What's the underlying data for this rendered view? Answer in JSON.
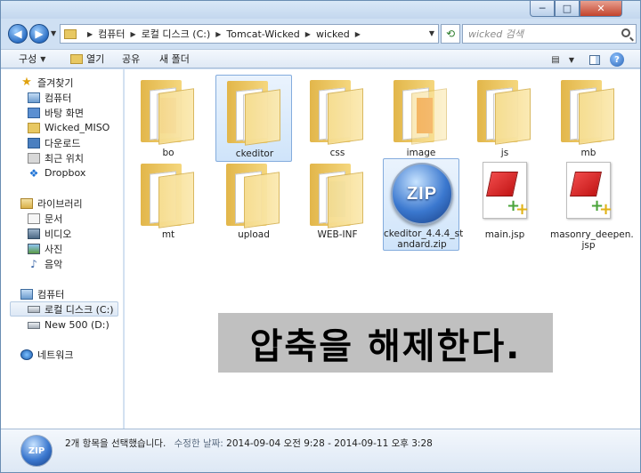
{
  "window": {
    "minimize_glyph": "─",
    "maximize_glyph": "□",
    "close_glyph": "✕"
  },
  "address": {
    "crumbs": [
      "컴퓨터",
      "로컬 디스크 (C:)",
      "Tomcat-Wicked",
      "wicked"
    ],
    "search_placeholder": "wicked 검색"
  },
  "toolbar": {
    "organize": "구성",
    "open": "열기",
    "share": "공유",
    "new_folder": "새 폴더"
  },
  "sidebar": {
    "favorites": "즐겨찾기",
    "fav_items": [
      "컴퓨터",
      "바탕 화면",
      "Wicked_MISO",
      "다운로드",
      "최근 위치",
      "Dropbox"
    ],
    "libraries": "라이브러리",
    "lib_items": [
      "문서",
      "비디오",
      "사진",
      "음악"
    ],
    "computer": "컴퓨터",
    "computer_items": [
      "로컬 디스크 (C:)",
      "New 500 (D:)"
    ],
    "network": "네트워크"
  },
  "files": [
    {
      "name": "bo",
      "type": "folder"
    },
    {
      "name": "ckeditor",
      "type": "folder"
    },
    {
      "name": "css",
      "type": "folder"
    },
    {
      "name": "image",
      "type": "folder"
    },
    {
      "name": "js",
      "type": "folder"
    },
    {
      "name": "mb",
      "type": "folder"
    },
    {
      "name": "mt",
      "type": "folder"
    },
    {
      "name": "upload",
      "type": "folder"
    },
    {
      "name": "WEB-INF",
      "type": "folder"
    },
    {
      "name": "ckeditor_4.4.4_standard.zip",
      "type": "zip",
      "label_line1": "ckeditor_4.4.4_st",
      "label_line2": "andard.zip"
    },
    {
      "name": "main.jsp",
      "type": "jsp"
    },
    {
      "name": "masonry_deepen.jsp",
      "type": "jsp",
      "label_line1": "masonry_deepen.",
      "label_line2": "jsp"
    }
  ],
  "zip_badge": "ZIP",
  "overlay": "압축을 해제한다.",
  "details": {
    "selection": "2개 항목을 선택했습니다.",
    "modified_label": "수정한 날짜:",
    "modified_value": "2014-09-04 오전 9:28 - 2014-09-11 오후 3:28"
  }
}
